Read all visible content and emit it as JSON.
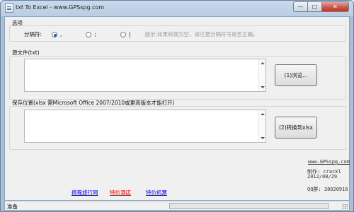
{
  "window": {
    "title": "txt To Excel - www.GPSspg.com",
    "min_glyph": "—",
    "max_glyph": "□",
    "close_glyph": "✕"
  },
  "options": {
    "group_label": "选项",
    "separator_label": "分隔符:",
    "radio1_label": ",",
    "radio2_label": ";",
    "radio3_label": "|",
    "selected": 1,
    "hint": "提示:如果转换为空，请注意分隔符号是否正确。"
  },
  "source": {
    "label": "源文件(txt)",
    "browse_button": "(1)浏览..."
  },
  "save": {
    "label": "保存位置(xlsx 需Microsoft Office 2007/2010或更高版本才能打开)",
    "convert_button": "(2)转换到xlsx"
  },
  "info": {
    "site_link": "www.GPSspg.com",
    "author": "制作: crackl",
    "date": "2012/08/29",
    "qq": "QQ群: 38020916"
  },
  "links": {
    "flight": "携程旅行网",
    "hotel": "特价酒店",
    "ticket": "特价机票"
  },
  "status": {
    "text": "准备",
    "progress": 0.0
  }
}
